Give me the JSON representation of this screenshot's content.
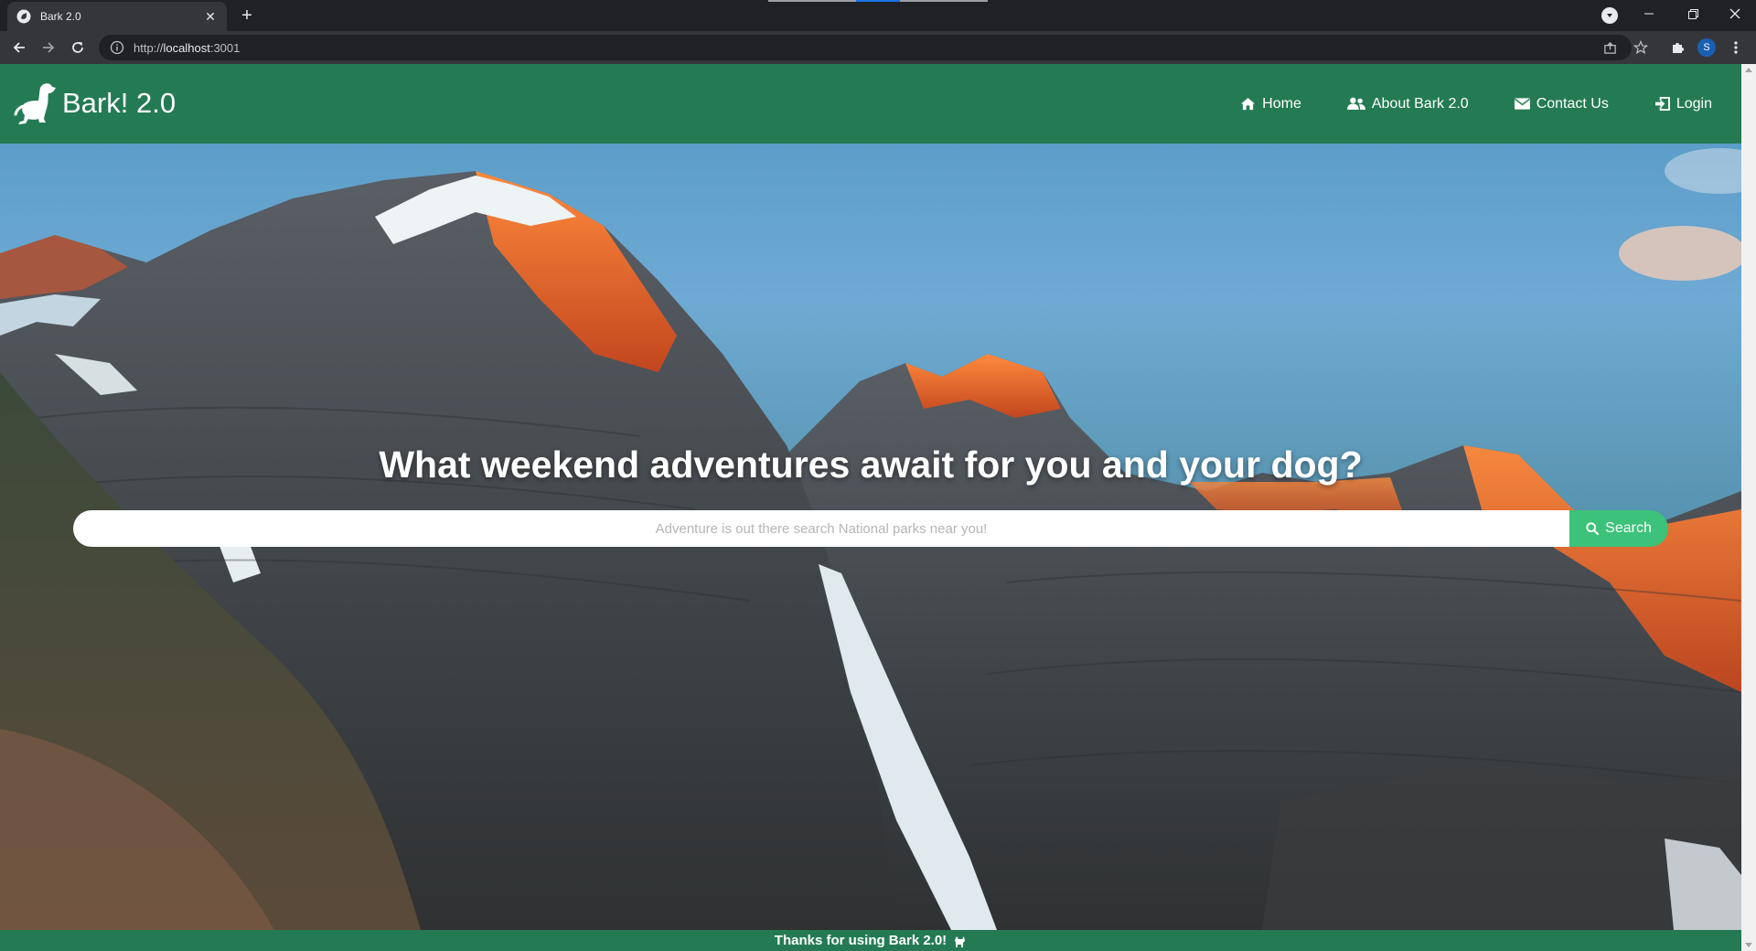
{
  "browser": {
    "tab_title": "Bark 2.0",
    "url_scheme": "http://",
    "url_host": "localhost",
    "url_port": ":3001",
    "profile_initial": "S"
  },
  "site": {
    "brand": "Bark! 2.0",
    "nav": [
      {
        "label": "Home",
        "icon": "home-icon"
      },
      {
        "label": "About Bark 2.0",
        "icon": "users-icon"
      },
      {
        "label": "Contact Us",
        "icon": "envelope-icon"
      },
      {
        "label": "Login",
        "icon": "login-icon"
      }
    ],
    "colors": {
      "nav_bg": "#247b53",
      "search_button": "#3cc27a"
    }
  },
  "hero": {
    "title": "What weekend adventures await for you and your dog?",
    "search_placeholder": "Adventure is out there search National parks near you!",
    "search_value": "",
    "search_button": "Search"
  },
  "footer": {
    "text": "Thanks for using Bark 2.0!"
  }
}
